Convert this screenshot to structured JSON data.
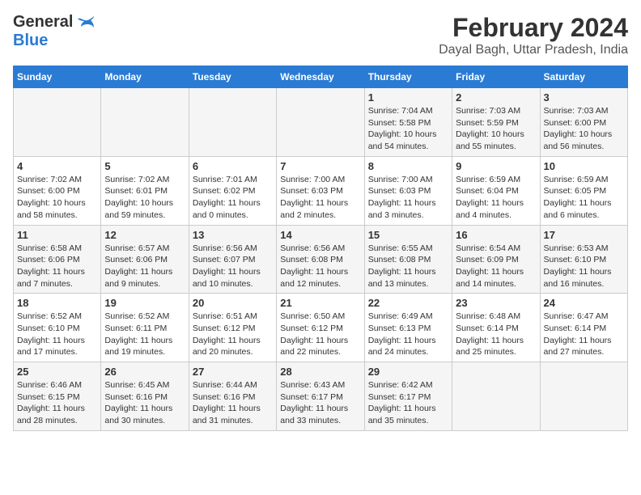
{
  "header": {
    "logo_general": "General",
    "logo_blue": "Blue",
    "title": "February 2024",
    "subtitle": "Dayal Bagh, Uttar Pradesh, India"
  },
  "weekdays": [
    "Sunday",
    "Monday",
    "Tuesday",
    "Wednesday",
    "Thursday",
    "Friday",
    "Saturday"
  ],
  "weeks": [
    [
      {
        "day": "",
        "info": ""
      },
      {
        "day": "",
        "info": ""
      },
      {
        "day": "",
        "info": ""
      },
      {
        "day": "",
        "info": ""
      },
      {
        "day": "1",
        "info": "Sunrise: 7:04 AM\nSunset: 5:58 PM\nDaylight: 10 hours\nand 54 minutes."
      },
      {
        "day": "2",
        "info": "Sunrise: 7:03 AM\nSunset: 5:59 PM\nDaylight: 10 hours\nand 55 minutes."
      },
      {
        "day": "3",
        "info": "Sunrise: 7:03 AM\nSunset: 6:00 PM\nDaylight: 10 hours\nand 56 minutes."
      }
    ],
    [
      {
        "day": "4",
        "info": "Sunrise: 7:02 AM\nSunset: 6:00 PM\nDaylight: 10 hours\nand 58 minutes."
      },
      {
        "day": "5",
        "info": "Sunrise: 7:02 AM\nSunset: 6:01 PM\nDaylight: 10 hours\nand 59 minutes."
      },
      {
        "day": "6",
        "info": "Sunrise: 7:01 AM\nSunset: 6:02 PM\nDaylight: 11 hours\nand 0 minutes."
      },
      {
        "day": "7",
        "info": "Sunrise: 7:00 AM\nSunset: 6:03 PM\nDaylight: 11 hours\nand 2 minutes."
      },
      {
        "day": "8",
        "info": "Sunrise: 7:00 AM\nSunset: 6:03 PM\nDaylight: 11 hours\nand 3 minutes."
      },
      {
        "day": "9",
        "info": "Sunrise: 6:59 AM\nSunset: 6:04 PM\nDaylight: 11 hours\nand 4 minutes."
      },
      {
        "day": "10",
        "info": "Sunrise: 6:59 AM\nSunset: 6:05 PM\nDaylight: 11 hours\nand 6 minutes."
      }
    ],
    [
      {
        "day": "11",
        "info": "Sunrise: 6:58 AM\nSunset: 6:06 PM\nDaylight: 11 hours\nand 7 minutes."
      },
      {
        "day": "12",
        "info": "Sunrise: 6:57 AM\nSunset: 6:06 PM\nDaylight: 11 hours\nand 9 minutes."
      },
      {
        "day": "13",
        "info": "Sunrise: 6:56 AM\nSunset: 6:07 PM\nDaylight: 11 hours\nand 10 minutes."
      },
      {
        "day": "14",
        "info": "Sunrise: 6:56 AM\nSunset: 6:08 PM\nDaylight: 11 hours\nand 12 minutes."
      },
      {
        "day": "15",
        "info": "Sunrise: 6:55 AM\nSunset: 6:08 PM\nDaylight: 11 hours\nand 13 minutes."
      },
      {
        "day": "16",
        "info": "Sunrise: 6:54 AM\nSunset: 6:09 PM\nDaylight: 11 hours\nand 14 minutes."
      },
      {
        "day": "17",
        "info": "Sunrise: 6:53 AM\nSunset: 6:10 PM\nDaylight: 11 hours\nand 16 minutes."
      }
    ],
    [
      {
        "day": "18",
        "info": "Sunrise: 6:52 AM\nSunset: 6:10 PM\nDaylight: 11 hours\nand 17 minutes."
      },
      {
        "day": "19",
        "info": "Sunrise: 6:52 AM\nSunset: 6:11 PM\nDaylight: 11 hours\nand 19 minutes."
      },
      {
        "day": "20",
        "info": "Sunrise: 6:51 AM\nSunset: 6:12 PM\nDaylight: 11 hours\nand 20 minutes."
      },
      {
        "day": "21",
        "info": "Sunrise: 6:50 AM\nSunset: 6:12 PM\nDaylight: 11 hours\nand 22 minutes."
      },
      {
        "day": "22",
        "info": "Sunrise: 6:49 AM\nSunset: 6:13 PM\nDaylight: 11 hours\nand 24 minutes."
      },
      {
        "day": "23",
        "info": "Sunrise: 6:48 AM\nSunset: 6:14 PM\nDaylight: 11 hours\nand 25 minutes."
      },
      {
        "day": "24",
        "info": "Sunrise: 6:47 AM\nSunset: 6:14 PM\nDaylight: 11 hours\nand 27 minutes."
      }
    ],
    [
      {
        "day": "25",
        "info": "Sunrise: 6:46 AM\nSunset: 6:15 PM\nDaylight: 11 hours\nand 28 minutes."
      },
      {
        "day": "26",
        "info": "Sunrise: 6:45 AM\nSunset: 6:16 PM\nDaylight: 11 hours\nand 30 minutes."
      },
      {
        "day": "27",
        "info": "Sunrise: 6:44 AM\nSunset: 6:16 PM\nDaylight: 11 hours\nand 31 minutes."
      },
      {
        "day": "28",
        "info": "Sunrise: 6:43 AM\nSunset: 6:17 PM\nDaylight: 11 hours\nand 33 minutes."
      },
      {
        "day": "29",
        "info": "Sunrise: 6:42 AM\nSunset: 6:17 PM\nDaylight: 11 hours\nand 35 minutes."
      },
      {
        "day": "",
        "info": ""
      },
      {
        "day": "",
        "info": ""
      }
    ]
  ]
}
